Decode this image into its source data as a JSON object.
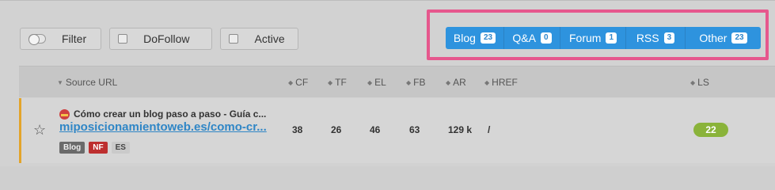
{
  "filters": {
    "filter_label": "Filter",
    "dofollow_label": "DoFollow",
    "active_label": "Active"
  },
  "type_tabs": [
    {
      "label": "Blog",
      "count": "23"
    },
    {
      "label": "Q&A",
      "count": "0"
    },
    {
      "label": "Forum",
      "count": "1"
    },
    {
      "label": "RSS",
      "count": "3"
    },
    {
      "label": "Other",
      "count": "23"
    }
  ],
  "table": {
    "columns": {
      "source_url": "Source URL",
      "cf": "CF",
      "tf": "TF",
      "el": "EL",
      "fb": "FB",
      "ar": "AR",
      "href": "HREF",
      "ls": "LS"
    },
    "rows": [
      {
        "title": "Cómo crear un blog paso a paso - Guía c...",
        "url": "miposicionamientoweb.es/como-cr...",
        "tags": [
          "Blog",
          "NF",
          "ES"
        ],
        "cf": "38",
        "tf": "26",
        "el": "46",
        "fb": "63",
        "ar": "129 k",
        "href": "/",
        "ls": "22"
      }
    ]
  },
  "colors": {
    "tabs_accent": "#2e93de",
    "highlight": "#e6578d",
    "ls_badge": "#8ab33a",
    "nf_tag": "#bd2f2f",
    "row_marker": "#e3a42a"
  }
}
